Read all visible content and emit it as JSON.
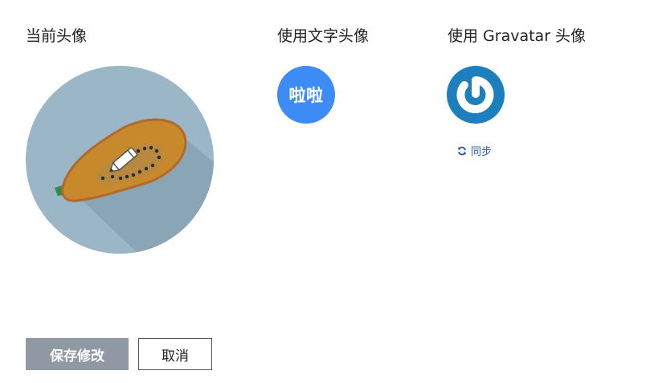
{
  "sections": {
    "current_title": "当前头像",
    "text_title": "使用文字头像",
    "gravatar_title": "使用 Gravatar 头像"
  },
  "text_avatar": {
    "label": "啦啦",
    "color": "#3d8cf6"
  },
  "current_avatar": {
    "icon": "papaya-icon",
    "overlay_icon": "pencil-icon",
    "background": "#9bb6c6"
  },
  "gravatar": {
    "icon": "gravatar-logo-icon",
    "color": "#1e7fbf",
    "sync_label": "同步",
    "sync_icon": "refresh-icon"
  },
  "actions": {
    "save_label": "保存修改",
    "cancel_label": "取消"
  }
}
